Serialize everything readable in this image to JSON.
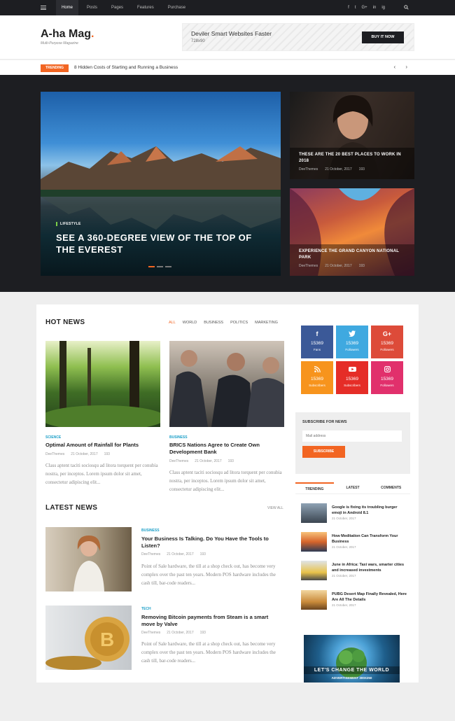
{
  "nav": {
    "items": [
      "Home",
      "Posts",
      "Pages",
      "Features",
      "Purchase"
    ]
  },
  "social_top": [
    "f",
    "t",
    "G+",
    "in",
    "ig"
  ],
  "brand": {
    "name": "A-ha Mag",
    "dot": ".",
    "tagline": "Multi-Purpose Magazine"
  },
  "ad_top": {
    "title": "Deviler Smart Websites Faster",
    "size": "728x90",
    "button": "BUY IT NOW"
  },
  "trending": {
    "badge": "TRENDING",
    "headline": "8 Hidden Costs of Starting and Running a Business",
    "arrows": "‹ ›"
  },
  "hero": {
    "main": {
      "category": "LIFESTYLE",
      "title": "SEE A 360-DEGREE VIEW OF THE TOP OF THE EVEREST"
    },
    "side1": {
      "title": "THESE ARE THE 20 BEST PLACES TO WORK IN 2018",
      "author": "DeeThemes",
      "date": "21 October, 2017",
      "views": "193"
    },
    "side2": {
      "title": "EXPERIENCE THE GRAND CANYON NATIONAL PARK",
      "author": "DeeThemes",
      "date": "21 October, 2017",
      "views": "193"
    }
  },
  "hot_news": {
    "title": "HOT NEWS",
    "tabs": [
      "ALL",
      "WORLD",
      "BUSINESS",
      "POLITICS",
      "MARKETING"
    ],
    "cards": [
      {
        "category": "SCIENCE",
        "title": "Optimal Amount of Rainfall for Plants",
        "author": "DeeThemes",
        "date": "21 October, 2017",
        "views": "193",
        "excerpt": "Class aptent taciti sociosqu ad litora torquent per conubia nostra, per inceptos. Lorem ipsum dolor sit amet, consectetur adipiscing elit..."
      },
      {
        "category": "BUSINESS",
        "title": "BRICS Nations Agree to Create Own Development Bank",
        "author": "DeeThemes",
        "date": "21 October, 2017",
        "views": "193",
        "excerpt": "Class aptent taciti sociosqu ad litora torquent per conubia nostra, per inceptos. Lorem ipsum dolor sit amet, consectetur adipiscing elit..."
      }
    ]
  },
  "latest_news": {
    "title": "LATEST NEWS",
    "view_all": "VIEW ALL",
    "items": [
      {
        "category": "BUSINESS",
        "title": "Your Business Is Talking. Do You Have the Tools to Listen?",
        "author": "DeeThemes",
        "date": "21 October, 2017",
        "views": "193",
        "excerpt": "Point of Sale hardware, the till at a shop check out, has become very complex over the past ten years. Modern POS hardware includes the cash till, bar-code readers..."
      },
      {
        "category": "TECH",
        "title": "Removing Bitcoin payments from Steam is a smart move by Valve",
        "author": "DeeThemes",
        "date": "21 October, 2017",
        "views": "193",
        "excerpt": "Point of Sale hardware, the till at a shop check out, has become very complex over the past ten years. Modern POS hardware includes the cash till, bar-code readers..."
      }
    ]
  },
  "social_counters": [
    {
      "icon": "f",
      "count": "15369",
      "label": "Fans",
      "color": "#3b5998"
    },
    {
      "icon": "t",
      "count": "15369",
      "label": "Followers",
      "color": "#3fa9e0"
    },
    {
      "icon": "G+",
      "count": "15369",
      "label": "Followers",
      "color": "#dd4b39"
    },
    {
      "icon": "rss",
      "count": "15369",
      "label": "Subscribers",
      "color": "#f7941d"
    },
    {
      "icon": "yt",
      "count": "15369",
      "label": "Subscribers",
      "color": "#e52d27"
    },
    {
      "icon": "ig",
      "count": "15369",
      "label": "Followers",
      "color": "#e1306c"
    }
  ],
  "subscribe": {
    "title": "SUBSCRIBE FOR NEWS",
    "placeholder": "Mail address",
    "button": "SUBSCRIBE"
  },
  "widget_tabs": [
    "TRENDING",
    "LATEST",
    "COMMENTS"
  ],
  "widget_items": [
    {
      "title": "Google is fixing its troubling burger emoji in Android 8.1",
      "date": "21 October, 2017"
    },
    {
      "title": "How Meditation Can Transform Your Business",
      "date": "21 October, 2017"
    },
    {
      "title": "June in Africa: Taxi wars, smarter cities and increased investments",
      "date": "21 October, 2017"
    },
    {
      "title": "PUBG Desert Map Finally Revealed, Here Are All The Details",
      "date": "21 October, 2017"
    }
  ],
  "ad_side": {
    "title": "LET'S CHANGE THE WORLD",
    "sub": "ADVERTISEMENT 300X250"
  },
  "colors": {
    "accent": "#f26522",
    "dark": "#1d1e22",
    "category": "#1ea0c8"
  }
}
